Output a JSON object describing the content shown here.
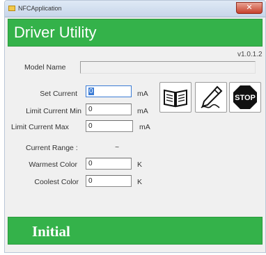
{
  "window": {
    "title": "NFCApplication",
    "close_glyph": "✕"
  },
  "header": {
    "title": "Driver Utility",
    "color": "#34b24a"
  },
  "version": "v1.0.1.2",
  "model": {
    "label": "Model Name",
    "value": ""
  },
  "fields": {
    "set_current": {
      "label": "Set Current",
      "value": "0",
      "unit": "mA"
    },
    "limit_min": {
      "label": "Limit Current Min",
      "value": "0",
      "unit": "mA"
    },
    "limit_max": {
      "label": "Limit Current Max",
      "value": "0",
      "unit": "mA"
    },
    "current_range": {
      "label": "Current Range :",
      "value": "~"
    },
    "warmest_color": {
      "label": "Warmest Color",
      "value": "0",
      "unit": "K"
    },
    "coolest_color": {
      "label": "Coolest Color",
      "value": "0",
      "unit": "K"
    }
  },
  "toolbar": {
    "read_icon": "open-book-icon",
    "write_icon": "pencil-write-icon",
    "stop_icon": "stop-sign-icon",
    "stop_label": "STOP"
  },
  "footer": {
    "status": "Initial"
  }
}
